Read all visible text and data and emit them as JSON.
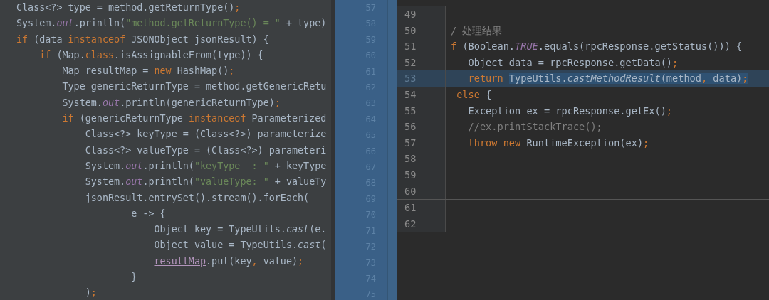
{
  "left_editor": {
    "lines": [
      {
        "tokens": [
          {
            "text": "Class<?> type = method.getReturnType()",
            "kind": "plain"
          },
          {
            "text": ";",
            "kind": "keyword"
          }
        ]
      },
      {
        "tokens": [
          {
            "text": "System.",
            "kind": "plain"
          },
          {
            "text": "out",
            "kind": "static-field"
          },
          {
            "text": ".println(",
            "kind": "plain"
          },
          {
            "text": "\"method.getReturnType() = \"",
            "kind": "string"
          },
          {
            "text": " + type)",
            "kind": "plain"
          }
        ]
      },
      {
        "tokens": [
          {
            "text": "if",
            "kind": "keyword"
          },
          {
            "text": " (data ",
            "kind": "plain"
          },
          {
            "text": "instanceof",
            "kind": "keyword"
          },
          {
            "text": " JSONObject jsonResult) {",
            "kind": "plain"
          }
        ]
      },
      {
        "tokens": [
          {
            "text": "    if",
            "kind": "keyword"
          },
          {
            "text": " (Map.",
            "kind": "plain"
          },
          {
            "text": "class",
            "kind": "keyword"
          },
          {
            "text": ".isAssignableFrom(type)) {",
            "kind": "plain"
          }
        ]
      },
      {
        "tokens": [
          {
            "text": "        Map resultMap = ",
            "kind": "plain"
          },
          {
            "text": "new",
            "kind": "keyword"
          },
          {
            "text": " HashMap()",
            "kind": "plain"
          },
          {
            "text": ";",
            "kind": "keyword"
          }
        ]
      },
      {
        "tokens": [
          {
            "text": "        Type genericReturnType = method.getGenericRetu",
            "kind": "plain"
          }
        ]
      },
      {
        "tokens": [
          {
            "text": "        System.",
            "kind": "plain"
          },
          {
            "text": "out",
            "kind": "static-field"
          },
          {
            "text": ".println(genericReturnType)",
            "kind": "plain"
          },
          {
            "text": ";",
            "kind": "keyword"
          }
        ]
      },
      {
        "tokens": [
          {
            "text": "        if",
            "kind": "keyword"
          },
          {
            "text": " (genericReturnType ",
            "kind": "plain"
          },
          {
            "text": "instanceof",
            "kind": "keyword"
          },
          {
            "text": " Parameterized",
            "kind": "plain"
          }
        ]
      },
      {
        "tokens": [
          {
            "text": "            Class<?> keyType = (Class<?>) parameterize",
            "kind": "plain"
          }
        ]
      },
      {
        "tokens": [
          {
            "text": "            Class<?> valueType = (Class<?>) parameteri",
            "kind": "plain"
          }
        ]
      },
      {
        "tokens": [
          {
            "text": "            System.",
            "kind": "plain"
          },
          {
            "text": "out",
            "kind": "static-field"
          },
          {
            "text": ".println(",
            "kind": "plain"
          },
          {
            "text": "\"keyType  : \"",
            "kind": "string"
          },
          {
            "text": " + keyType",
            "kind": "plain"
          }
        ]
      },
      {
        "tokens": [
          {
            "text": "            System.",
            "kind": "plain"
          },
          {
            "text": "out",
            "kind": "static-field"
          },
          {
            "text": ".println(",
            "kind": "plain"
          },
          {
            "text": "\"valueType: \"",
            "kind": "string"
          },
          {
            "text": " + valueTy",
            "kind": "plain"
          }
        ]
      },
      {
        "tokens": [
          {
            "text": "            jsonResult.entrySet().stream().forEach(",
            "kind": "plain"
          }
        ]
      },
      {
        "tokens": [
          {
            "text": "                    e -> {",
            "kind": "plain"
          }
        ]
      },
      {
        "tokens": [
          {
            "text": "                        Object key = TypeUtils.",
            "kind": "plain"
          },
          {
            "text": "cast",
            "kind": "static-call"
          },
          {
            "text": "(e.",
            "kind": "plain"
          }
        ]
      },
      {
        "tokens": [
          {
            "text": "                        Object value = TypeUtils.",
            "kind": "plain"
          },
          {
            "text": "cast",
            "kind": "static-call"
          },
          {
            "text": "(",
            "kind": "plain"
          }
        ]
      },
      {
        "tokens": [
          {
            "text": "                        resultMap",
            "kind": "reassigned-var"
          },
          {
            "text": ".put(key",
            "kind": "plain"
          },
          {
            "text": ",",
            "kind": "keyword"
          },
          {
            "text": " value)",
            "kind": "plain"
          },
          {
            "text": ";",
            "kind": "keyword"
          }
        ]
      },
      {
        "tokens": [
          {
            "text": "                    }",
            "kind": "plain"
          }
        ]
      },
      {
        "tokens": [
          {
            "text": "            )",
            "kind": "plain"
          },
          {
            "text": ";",
            "kind": "keyword"
          }
        ]
      }
    ]
  },
  "middle_gutter": {
    "line_numbers": [
      "57",
      "58",
      "59",
      "60",
      "61",
      "62",
      "63",
      "64",
      "65",
      "66",
      "67",
      "68",
      "69",
      "70",
      "71",
      "72",
      "73",
      "74",
      "75"
    ]
  },
  "right_editor": {
    "lines": [
      {
        "number": "49",
        "selected": false
      },
      {
        "number": "50",
        "selected": false,
        "tokens": [
          {
            "text": "/ 处理结果",
            "kind": "comment"
          }
        ]
      },
      {
        "number": "51",
        "selected": false,
        "tokens": [
          {
            "text": "f",
            "kind": "keyword"
          },
          {
            "text": " (Boolean.",
            "kind": "plain"
          },
          {
            "text": "TRUE",
            "kind": "static-field"
          },
          {
            "text": ".equals(rpcResponse.getStatus())) {",
            "kind": "plain"
          }
        ]
      },
      {
        "number": "52",
        "selected": false,
        "tokens": [
          {
            "text": "   Object data = rpcResponse.getData()",
            "kind": "plain"
          },
          {
            "text": ";",
            "kind": "keyword"
          }
        ]
      },
      {
        "number": "53",
        "selected": true,
        "tokens": [
          {
            "text": "   return ",
            "kind": "keyword",
            "highlighted": false
          },
          {
            "text": "TypeUtils.",
            "kind": "plain",
            "highlighted": true
          },
          {
            "text": "castMethodResult",
            "kind": "static-call",
            "highlighted": true
          },
          {
            "text": "(method",
            "kind": "plain",
            "highlighted": true
          },
          {
            "text": ",",
            "kind": "keyword",
            "highlighted": true
          },
          {
            "text": " data)",
            "kind": "plain",
            "highlighted": true
          },
          {
            "text": ";",
            "kind": "keyword",
            "highlighted": true
          }
        ]
      },
      {
        "number": "54",
        "selected": false,
        "tokens": [
          {
            "text": " else",
            "kind": "keyword"
          },
          {
            "text": " {",
            "kind": "plain"
          }
        ]
      },
      {
        "number": "55",
        "selected": false,
        "tokens": [
          {
            "text": "   Exception ex = rpcResponse.getEx()",
            "kind": "plain"
          },
          {
            "text": ";",
            "kind": "keyword"
          }
        ]
      },
      {
        "number": "56",
        "selected": false,
        "tokens": [
          {
            "text": "   //ex.printStackTrace();",
            "kind": "comment"
          }
        ]
      },
      {
        "number": "57",
        "selected": false,
        "tokens": [
          {
            "text": "   throw",
            "kind": "keyword"
          },
          {
            "text": " new",
            "kind": "keyword"
          },
          {
            "text": " RuntimeException(ex)",
            "kind": "plain"
          },
          {
            "text": ";",
            "kind": "keyword"
          }
        ]
      },
      {
        "number": "58",
        "selected": false
      },
      {
        "number": "59",
        "selected": false
      },
      {
        "number": "60",
        "selected": false,
        "divider_below": true
      },
      {
        "number": "61",
        "selected": false
      },
      {
        "number": "62",
        "selected": false
      }
    ]
  }
}
